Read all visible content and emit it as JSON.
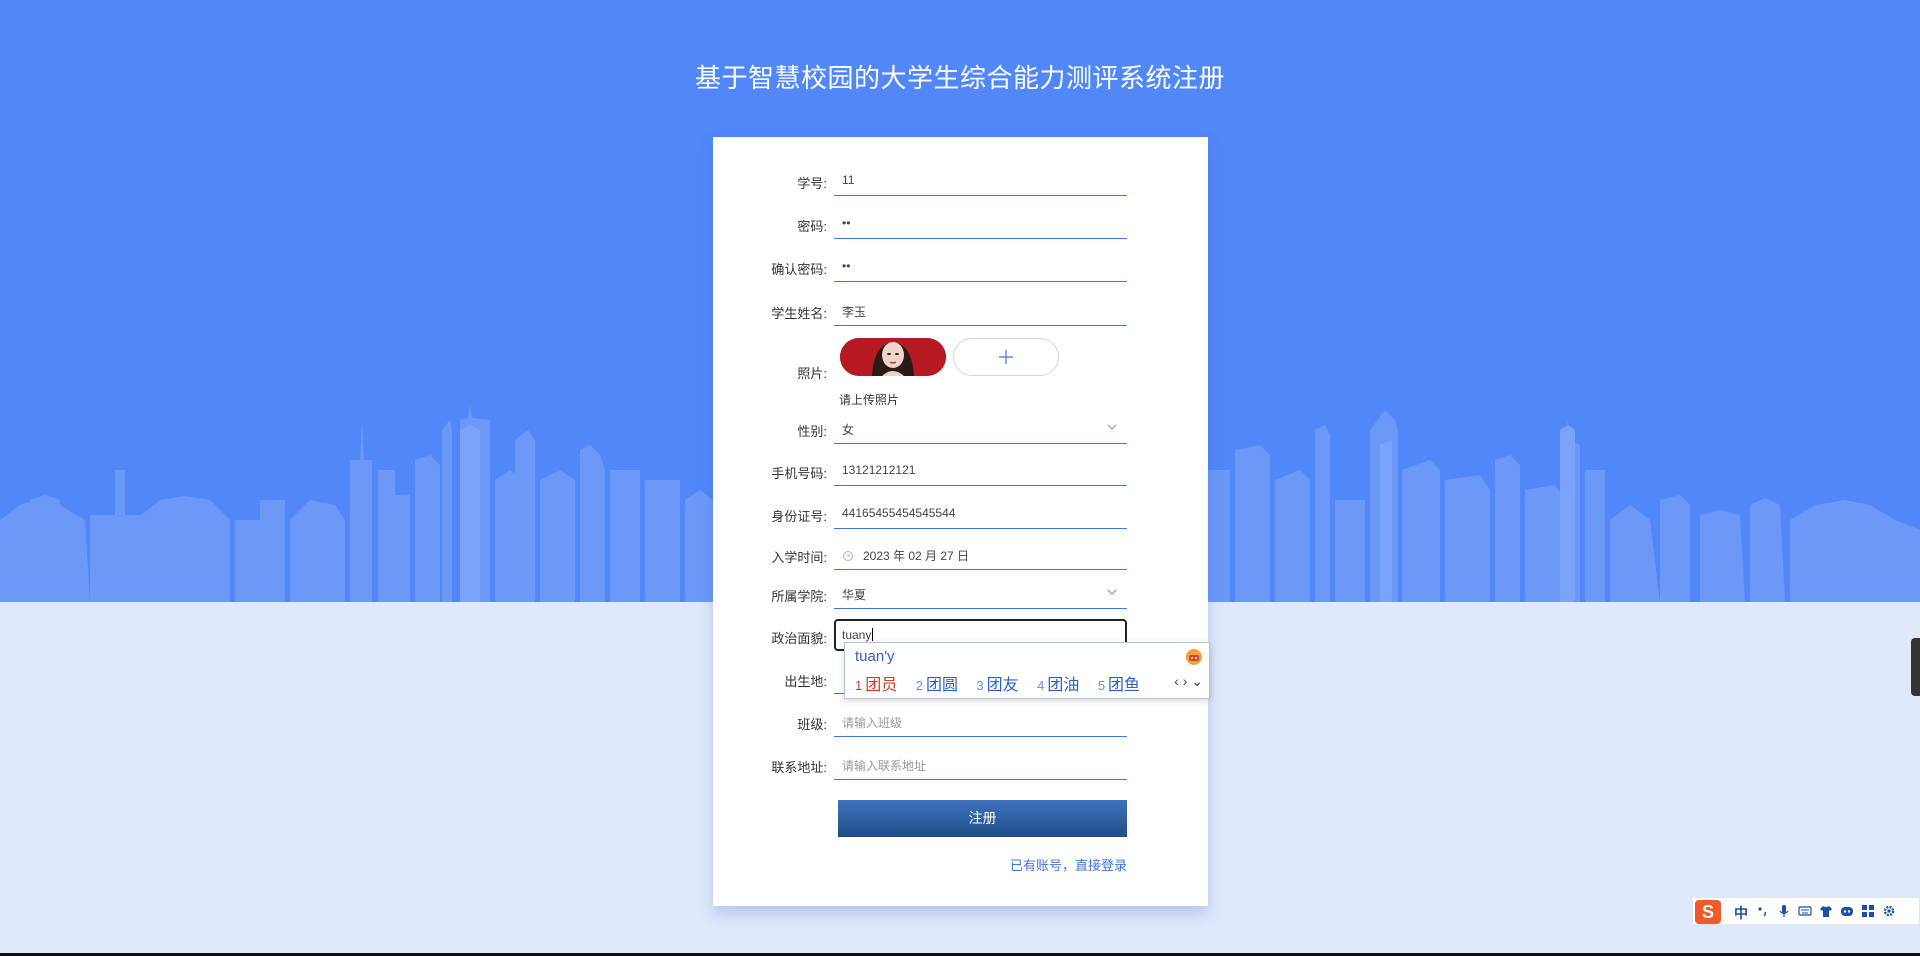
{
  "page": {
    "title": "基于智慧校园的大学生综合能力测评系统注册"
  },
  "form": {
    "student_id": {
      "label": "学号:",
      "value": "11"
    },
    "password": {
      "label": "密码:",
      "value": "••"
    },
    "confirm_password": {
      "label": "确认密码:",
      "value": "••"
    },
    "student_name": {
      "label": "学生姓名:",
      "value": "李玉"
    },
    "photo": {
      "label": "照片:",
      "hint": "请上传照片",
      "upload_icon": "plus-icon"
    },
    "gender": {
      "label": "性别:",
      "value": "女"
    },
    "phone": {
      "label": "手机号码:",
      "value": "13121212121"
    },
    "id_card": {
      "label": "身份证号:",
      "value": "44165455454545544"
    },
    "enroll_date": {
      "label": "入学时间:",
      "value": "2023 年 02 月 27 日",
      "icon": "clock-icon"
    },
    "college": {
      "label": "所属学院:",
      "value": "华夏"
    },
    "political_status": {
      "label": "政治面貌:",
      "value": "tuany"
    },
    "birthplace": {
      "label": "出生地:"
    },
    "class": {
      "label": "班级:",
      "placeholder": "请输入班级"
    },
    "address": {
      "label": "联系地址:",
      "placeholder": "请输入联系地址"
    },
    "submit_label": "注册",
    "login_link": "已有账号，直接登录"
  },
  "ime": {
    "composition": "tuan'y",
    "candidates": [
      {
        "num": "1",
        "text": "团员"
      },
      {
        "num": "2",
        "text": "团圆"
      },
      {
        "num": "3",
        "text": "团友"
      },
      {
        "num": "4",
        "text": "团油"
      },
      {
        "num": "5",
        "text": "团鱼"
      }
    ],
    "nav": "‹ › ⌄",
    "toolbar": {
      "logo": "S",
      "mode": "中"
    }
  },
  "colors": {
    "header_bg": "#5187f9",
    "skyline": "#6f9cf8",
    "page_bg": "#dfe9fb",
    "accent": "#3e78d8",
    "button": "#1f4d86"
  }
}
